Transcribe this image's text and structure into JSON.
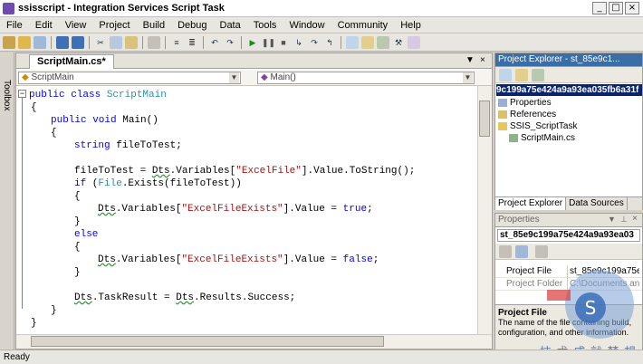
{
  "window": {
    "title": "ssisscript - Integration Services Script Task",
    "controls": [
      "minimize",
      "restore",
      "close"
    ]
  },
  "menu": [
    "File",
    "Edit",
    "View",
    "Project",
    "Build",
    "Debug",
    "Data",
    "Tools",
    "Window",
    "Community",
    "Help"
  ],
  "toolbox": {
    "label": "Toolbox"
  },
  "editor": {
    "tab": "ScriptMain.cs*",
    "class_combo": "ScriptMain",
    "member_combo": "Main()",
    "code": {
      "l1_kw": "public class",
      "l1_cls": "ScriptMain",
      "l2": "{",
      "l3_kw": "public void",
      "l3_rest": "Main()",
      "l4": "{",
      "l5_kw": "string",
      "l5_rest": "fileToTest;",
      "l6_a": "fileToTest = ",
      "l6_dts": "Dts",
      "l6_b": ".Variables[",
      "l6_str": "\"ExcelFile\"",
      "l6_c": "].Value.ToString();",
      "l7_kw": "if",
      "l7_a": " (",
      "l7_type": "File",
      "l7_b": ".Exists(fileToTest))",
      "l8": "{",
      "l9_dts": "Dts",
      "l9_a": ".Variables[",
      "l9_str": "\"ExcelFileExists\"",
      "l9_b": "].Value = ",
      "l9_val": "true",
      "l9_c": ";",
      "l10": "}",
      "l11_kw": "else",
      "l12": "{",
      "l13_dts": "Dts",
      "l13_a": ".Variables[",
      "l13_str": "\"ExcelFileExists\"",
      "l13_b": "].Value = ",
      "l13_val": "false",
      "l13_c": ";",
      "l14": "}",
      "l15_dts1": "Dts",
      "l15_a": ".TaskResult = ",
      "l15_dts2": "Dts",
      "l15_b": ".Results.Success;",
      "l16": "}",
      "l17": "}"
    }
  },
  "project_explorer": {
    "title": "Project Explorer - st_85e9c1...",
    "selected_node": "9c199a75e424a9a93ea035fb6a31f",
    "items": [
      "Properties",
      "References",
      "SSIS_ScriptTask",
      "ScriptMain.cs"
    ],
    "tabs": [
      "Project Explorer",
      "Data Sources"
    ]
  },
  "properties": {
    "title": "Properties",
    "object": "st_85e9c199a75e424a9a93ea03",
    "rows": [
      {
        "name": "Project File",
        "value": "st_85e9c199a75e4"
      },
      {
        "name": "Project Folder",
        "value": "C:\\Documents and Se"
      }
    ],
    "desc_title": "Project File",
    "desc_text": "The name of the file containing build, configuration, and other information."
  },
  "status": {
    "text": "Ready"
  },
  "watermark": {
    "text": "技 术 成 就 梦 想"
  },
  "colors": {
    "keyword": "#0000ff",
    "string": "#a31515",
    "type": "#2b91af",
    "selection": "#0a246a"
  }
}
